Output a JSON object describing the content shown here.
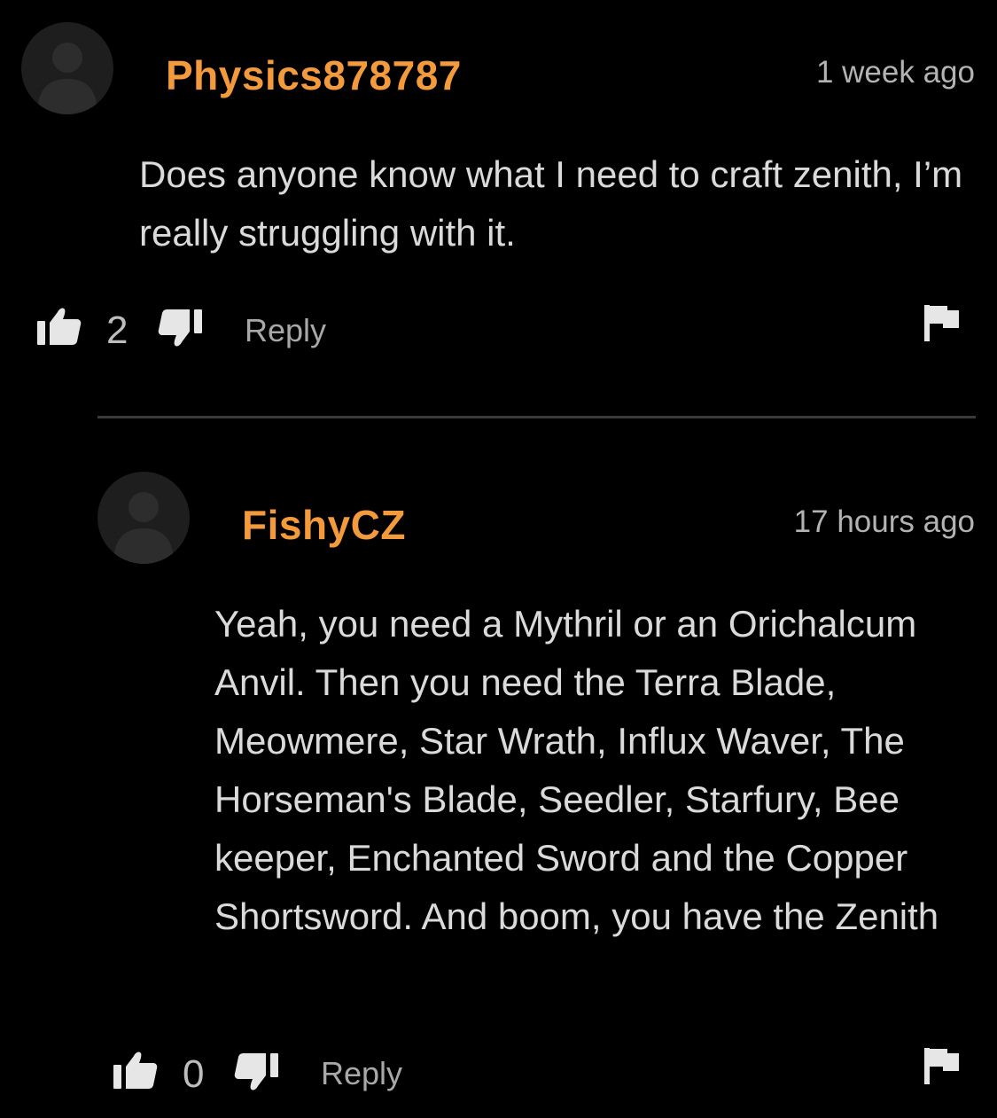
{
  "comments": [
    {
      "username": "Physics878787",
      "timestamp": "1 week ago",
      "body": "Does anyone know what I need to craft zenith, I’m really struggling with it.",
      "like_count": "2",
      "reply_label": "Reply",
      "avatar_icon": "default-avatar-icon"
    },
    {
      "username": "FishyCZ",
      "timestamp": "17 hours ago",
      "body": "Yeah, you need a Mythril or an Orichalcum Anvil. Then you need the Terra Blade, Meowmere, Star Wrath, Influx Waver, The Horseman's Blade, Seedler, Starfury, Bee keeper, Enchanted Sword and the Copper Shortsword. And boom, you have the Zenith",
      "like_count": "0",
      "reply_label": "Reply",
      "avatar_icon": "default-avatar-icon"
    }
  ],
  "colors": {
    "background": "#000000",
    "username": "#f39a3c",
    "text": "#dadada",
    "muted": "#a8a8a8",
    "icon": "#e6e6e6",
    "avatar": "#1e1e1e",
    "divider": "#3a3a3a"
  },
  "icons": [
    "thumbs-up-icon",
    "thumbs-down-icon",
    "flag-icon",
    "default-avatar-icon"
  ]
}
